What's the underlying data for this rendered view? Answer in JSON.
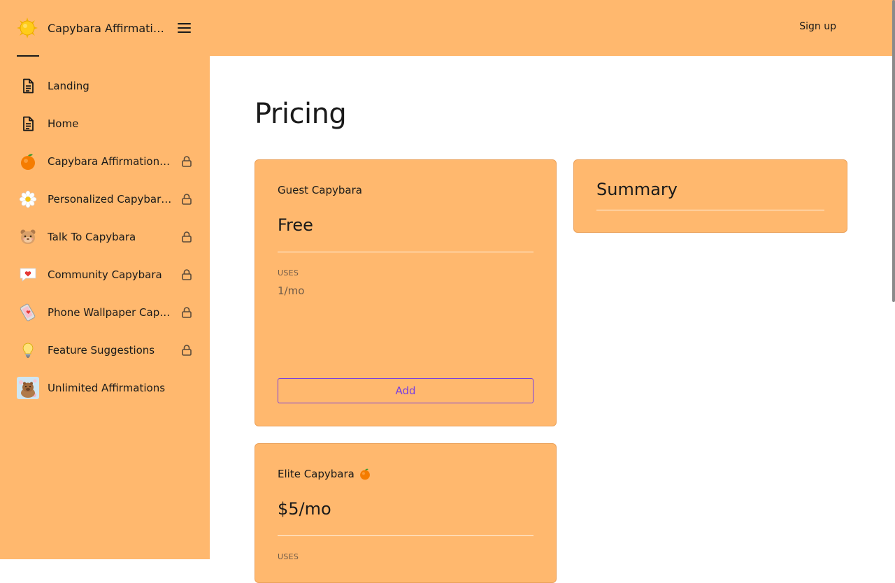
{
  "sidebar": {
    "brand": {
      "name": "Capybara Affirmations",
      "logo": "sun-icon"
    },
    "menu_icon": "hamburger-menu-icon",
    "items": [
      {
        "label": "Landing",
        "icon": "document-icon",
        "locked": false
      },
      {
        "label": "Home",
        "icon": "document-icon",
        "locked": false
      },
      {
        "label": "Capybara Affirmation AI",
        "icon": "orange-icon",
        "locked": true
      },
      {
        "label": "Personalized Capybara Affirmations",
        "icon": "daisy-icon",
        "locked": true
      },
      {
        "label": "Talk To Capybara",
        "icon": "capybara-face-icon",
        "locked": true
      },
      {
        "label": "Community Capybara",
        "icon": "heart-speech-bubble-icon",
        "locked": true
      },
      {
        "label": "Phone Wallpaper Capybara",
        "icon": "phone-heart-icon",
        "locked": true
      },
      {
        "label": "Feature Suggestions",
        "icon": "lightbulb-icon",
        "locked": true
      },
      {
        "label": "Unlimited Affirmations",
        "icon": "capybara-photo-icon",
        "locked": false
      }
    ]
  },
  "topbar": {
    "signup_label": "Sign up"
  },
  "main": {
    "title": "Pricing",
    "plans": [
      {
        "name": "Guest Capybara",
        "emoji": "",
        "price": "Free",
        "uses_label": "USES",
        "uses_value": "1/mo",
        "button_label": "Add"
      },
      {
        "name": "Elite Capybara",
        "emoji": "orange-icon",
        "price": "$5/mo",
        "uses_label": "USES"
      }
    ],
    "summary": {
      "title": "Summary"
    }
  },
  "colors": {
    "accent_orange": "#ffb86e",
    "card_border": "#eba15a",
    "button_purple": "#7a3fe0",
    "muted_text": "#6e5a48"
  }
}
